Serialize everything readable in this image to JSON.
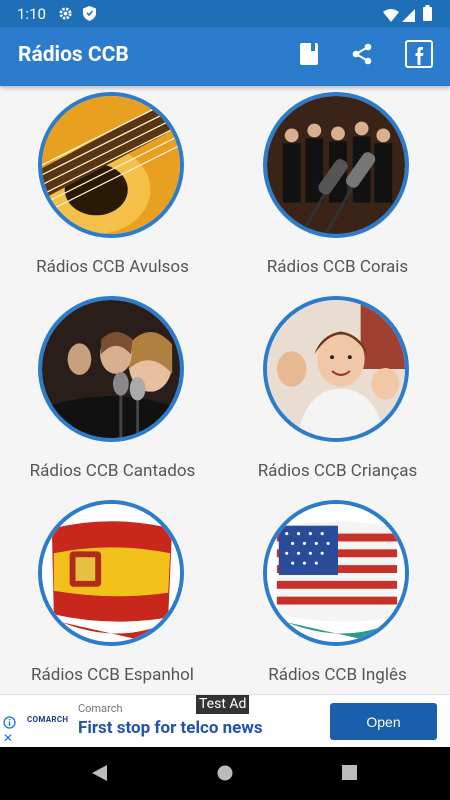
{
  "status": {
    "time": "1:10"
  },
  "appbar": {
    "title": "Rádios CCB",
    "actions": [
      "book-icon",
      "share-icon",
      "facebook-icon"
    ]
  },
  "categories": [
    {
      "label": "Rádios CCB Avulsos"
    },
    {
      "label": "Rádios CCB Corais"
    },
    {
      "label": "Rádios CCB Cantados"
    },
    {
      "label": "Rádios CCB Crianças"
    },
    {
      "label": "Rádios CCB Espanhol"
    },
    {
      "label": "Rádios CCB Inglês"
    }
  ],
  "ad": {
    "badge": "Test Ad",
    "logo_text": "COMARCH",
    "brand": "Comarch",
    "headline": "First stop for telco news",
    "cta": "Open"
  },
  "colors": {
    "primary": "#2b7ccc",
    "status": "#1f6fb8",
    "cta": "#1a5fab"
  }
}
